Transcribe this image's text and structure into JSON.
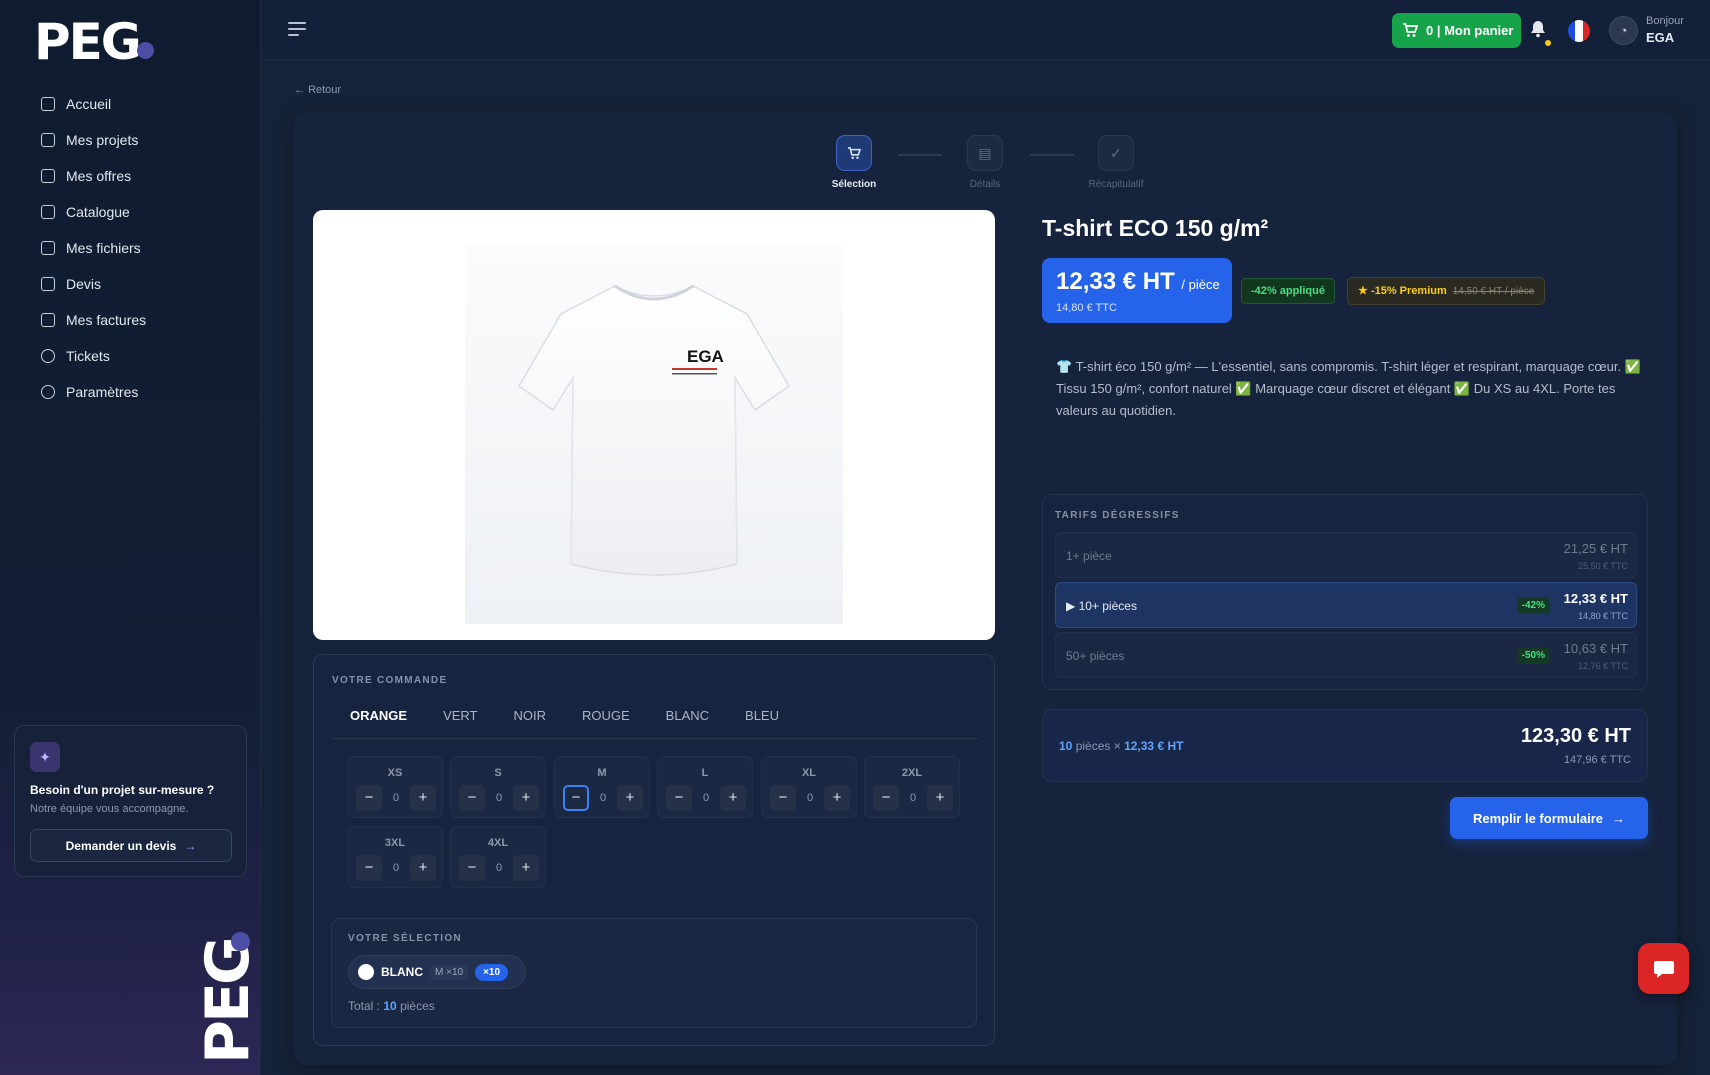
{
  "logo": {
    "text": "PEG"
  },
  "sidebar": {
    "items": [
      {
        "label": "Accueil",
        "icon": "home-icon"
      },
      {
        "label": "Mes projets",
        "icon": "projects-icon"
      },
      {
        "label": "Mes offres",
        "icon": "offers-icon"
      },
      {
        "label": "Catalogue",
        "icon": "grid-icon"
      },
      {
        "label": "Mes fichiers",
        "icon": "folder-icon"
      },
      {
        "label": "Devis",
        "icon": "quote-icon"
      },
      {
        "label": "Mes factures",
        "icon": "invoice-icon"
      },
      {
        "label": "Tickets",
        "icon": "ticket-icon"
      },
      {
        "label": "Paramètres",
        "icon": "gear-icon"
      }
    ],
    "promo": {
      "title": "Besoin d'un projet sur-mesure ?",
      "subtitle": "Notre équipe vous accompagne.",
      "button": "Demander un devis"
    }
  },
  "topbar": {
    "cart_label": "0 | Mon panier",
    "greeting": "Bonjour",
    "user": "EGA",
    "cart_color": "#16a34a"
  },
  "back_label": "Retour",
  "steps": [
    {
      "label": "Sélection",
      "state": "active"
    },
    {
      "label": "Détails",
      "state": "pending"
    },
    {
      "label": "Récapitulatif",
      "state": "pending"
    }
  ],
  "product": {
    "title": "T-shirt ECO 150 g/m²",
    "price_ht": "12,33 € HT",
    "price_unit": "/ pièce",
    "price_ttc": "14,80 € TTC",
    "discount_badge": "-42% appliqué",
    "premium_badge": "-15% Premium",
    "premium_old": "14,50 € HT / pièce",
    "description": "👕 T-shirt éco 150 g/m² — L'essentiel, sans compromis. T-shirt léger et respirant, marquage cœur. ✅ Tissu 150 g/m², confort naturel ✅ Marquage cœur discret et élégant ✅ Du XS au 4XL. Porte tes valeurs au quotidien.",
    "logo_text": "EGA"
  },
  "order": {
    "section_label": "VOTRE COMMANDE",
    "colors": [
      "ORANGE",
      "VERT",
      "NOIR",
      "ROUGE",
      "BLANC",
      "BLEU"
    ],
    "active_color": "ORANGE",
    "sizes": [
      {
        "name": "XS",
        "qty": "0"
      },
      {
        "name": "S",
        "qty": "0"
      },
      {
        "name": "M",
        "qty": "0"
      },
      {
        "name": "L",
        "qty": "0"
      },
      {
        "name": "XL",
        "qty": "0"
      },
      {
        "name": "2XL",
        "qty": "0"
      },
      {
        "name": "3XL",
        "qty": "0"
      },
      {
        "name": "4XL",
        "qty": "0"
      }
    ],
    "selection_label": "VOTRE SÉLECTION",
    "chip": {
      "color": "BLANC",
      "sizes": "M ×10",
      "qty": "×10"
    },
    "total_prefix": "Total :",
    "total_qty": "10",
    "total_suffix": "pièces"
  },
  "tiers": {
    "label": "TARIFS DÉGRESSIFS",
    "rows": [
      {
        "name": "1+ pièce",
        "ht": "21,25 € HT",
        "ttc": "25,50 € TTC",
        "discount": ""
      },
      {
        "name": "▶ 10+ pièces",
        "ht": "12,33 € HT",
        "ttc": "14,80 € TTC",
        "discount": "-42%"
      },
      {
        "name": "50+ pièces",
        "ht": "10,63 € HT",
        "ttc": "12,76 € TTC",
        "discount": "-50%"
      }
    ]
  },
  "summary": {
    "qty": "10",
    "qty_label": "pièces ×",
    "unit": "12,33 € HT",
    "total_ht": "123,30 € HT",
    "total_ttc": "147,96 € TTC"
  },
  "form_button": "Remplir le formulaire"
}
